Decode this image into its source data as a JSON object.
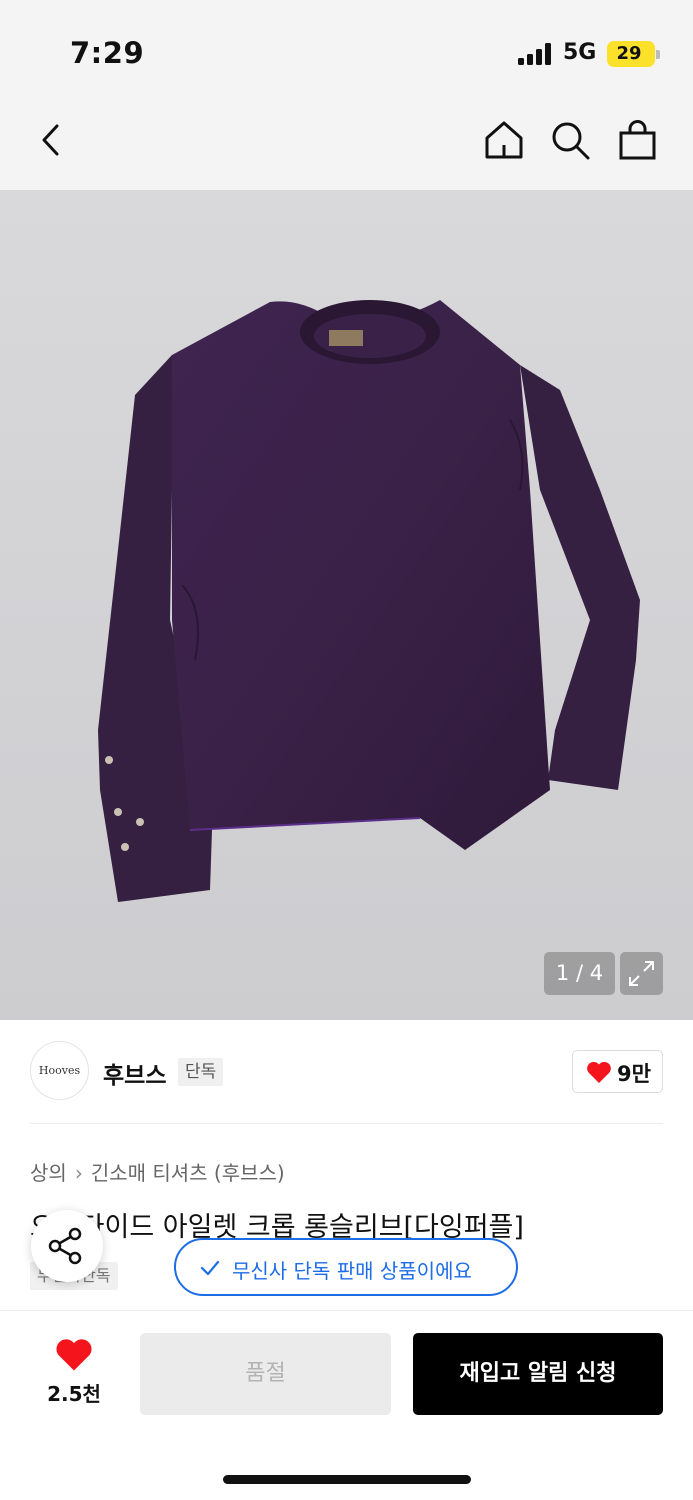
{
  "status_bar": {
    "time": "7:29",
    "network": "5G",
    "battery": "29",
    "signal_icon": "signal-bars-icon",
    "battery_color": "#fce12a"
  },
  "nav": {
    "back_icon": "chevron-left-icon",
    "home_icon": "home-icon",
    "search_icon": "search-icon",
    "cart_icon": "shopping-bag-icon"
  },
  "gallery": {
    "pager": "1 / 4",
    "current": 1,
    "total": 4,
    "expand_icon": "expand-icon",
    "product_label": "Hooves"
  },
  "brand": {
    "logo_text": "Hooves",
    "name": "후브스",
    "exclusive_badge": "단독",
    "likes": "9만"
  },
  "breadcrumb": {
    "items": [
      "상의",
      "긴소매 티셔츠 (후브스)"
    ]
  },
  "product": {
    "title": "오버다이드 아일렛 크롭 롱슬리브[다잉퍼플]",
    "sub_badge": "무신사단독",
    "garment_color": "#3b2248"
  },
  "toast": {
    "text": "무신사 단독 판매 상품이에요",
    "accent": "#1d6ce8"
  },
  "bottom_bar": {
    "wish_count": "2.5천",
    "soldout_label": "품절",
    "restock_label": "재입고 알림 신청",
    "heart_color": "#f4141b"
  }
}
